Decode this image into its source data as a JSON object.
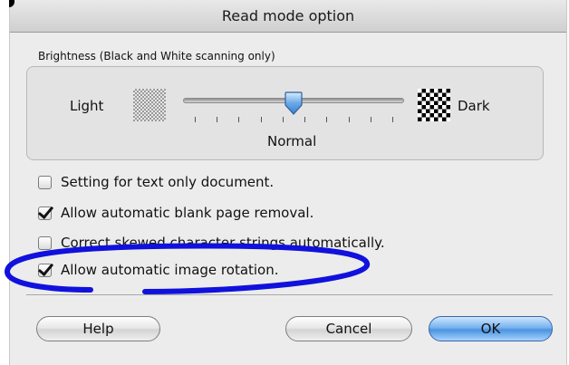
{
  "window": {
    "title": "Read mode option"
  },
  "brightness": {
    "group_label": "Brightness (Black and White scanning only)",
    "light_label": "Light",
    "dark_label": "Dark",
    "current_label": "Normal",
    "slider_fraction": 0.5,
    "tick_count": 10
  },
  "options": [
    {
      "label": "Setting for text only document.",
      "checked": false
    },
    {
      "label": "Allow automatic blank page removal.",
      "checked": true
    },
    {
      "label": "Correct skewed character strings automatically.",
      "checked": false
    },
    {
      "label": "Allow automatic image rotation.",
      "checked": true
    }
  ],
  "buttons": {
    "help": "Help",
    "cancel": "Cancel",
    "ok": "OK"
  },
  "colors": {
    "annotation": "#1111dd",
    "default_button": "#4c93e0"
  }
}
